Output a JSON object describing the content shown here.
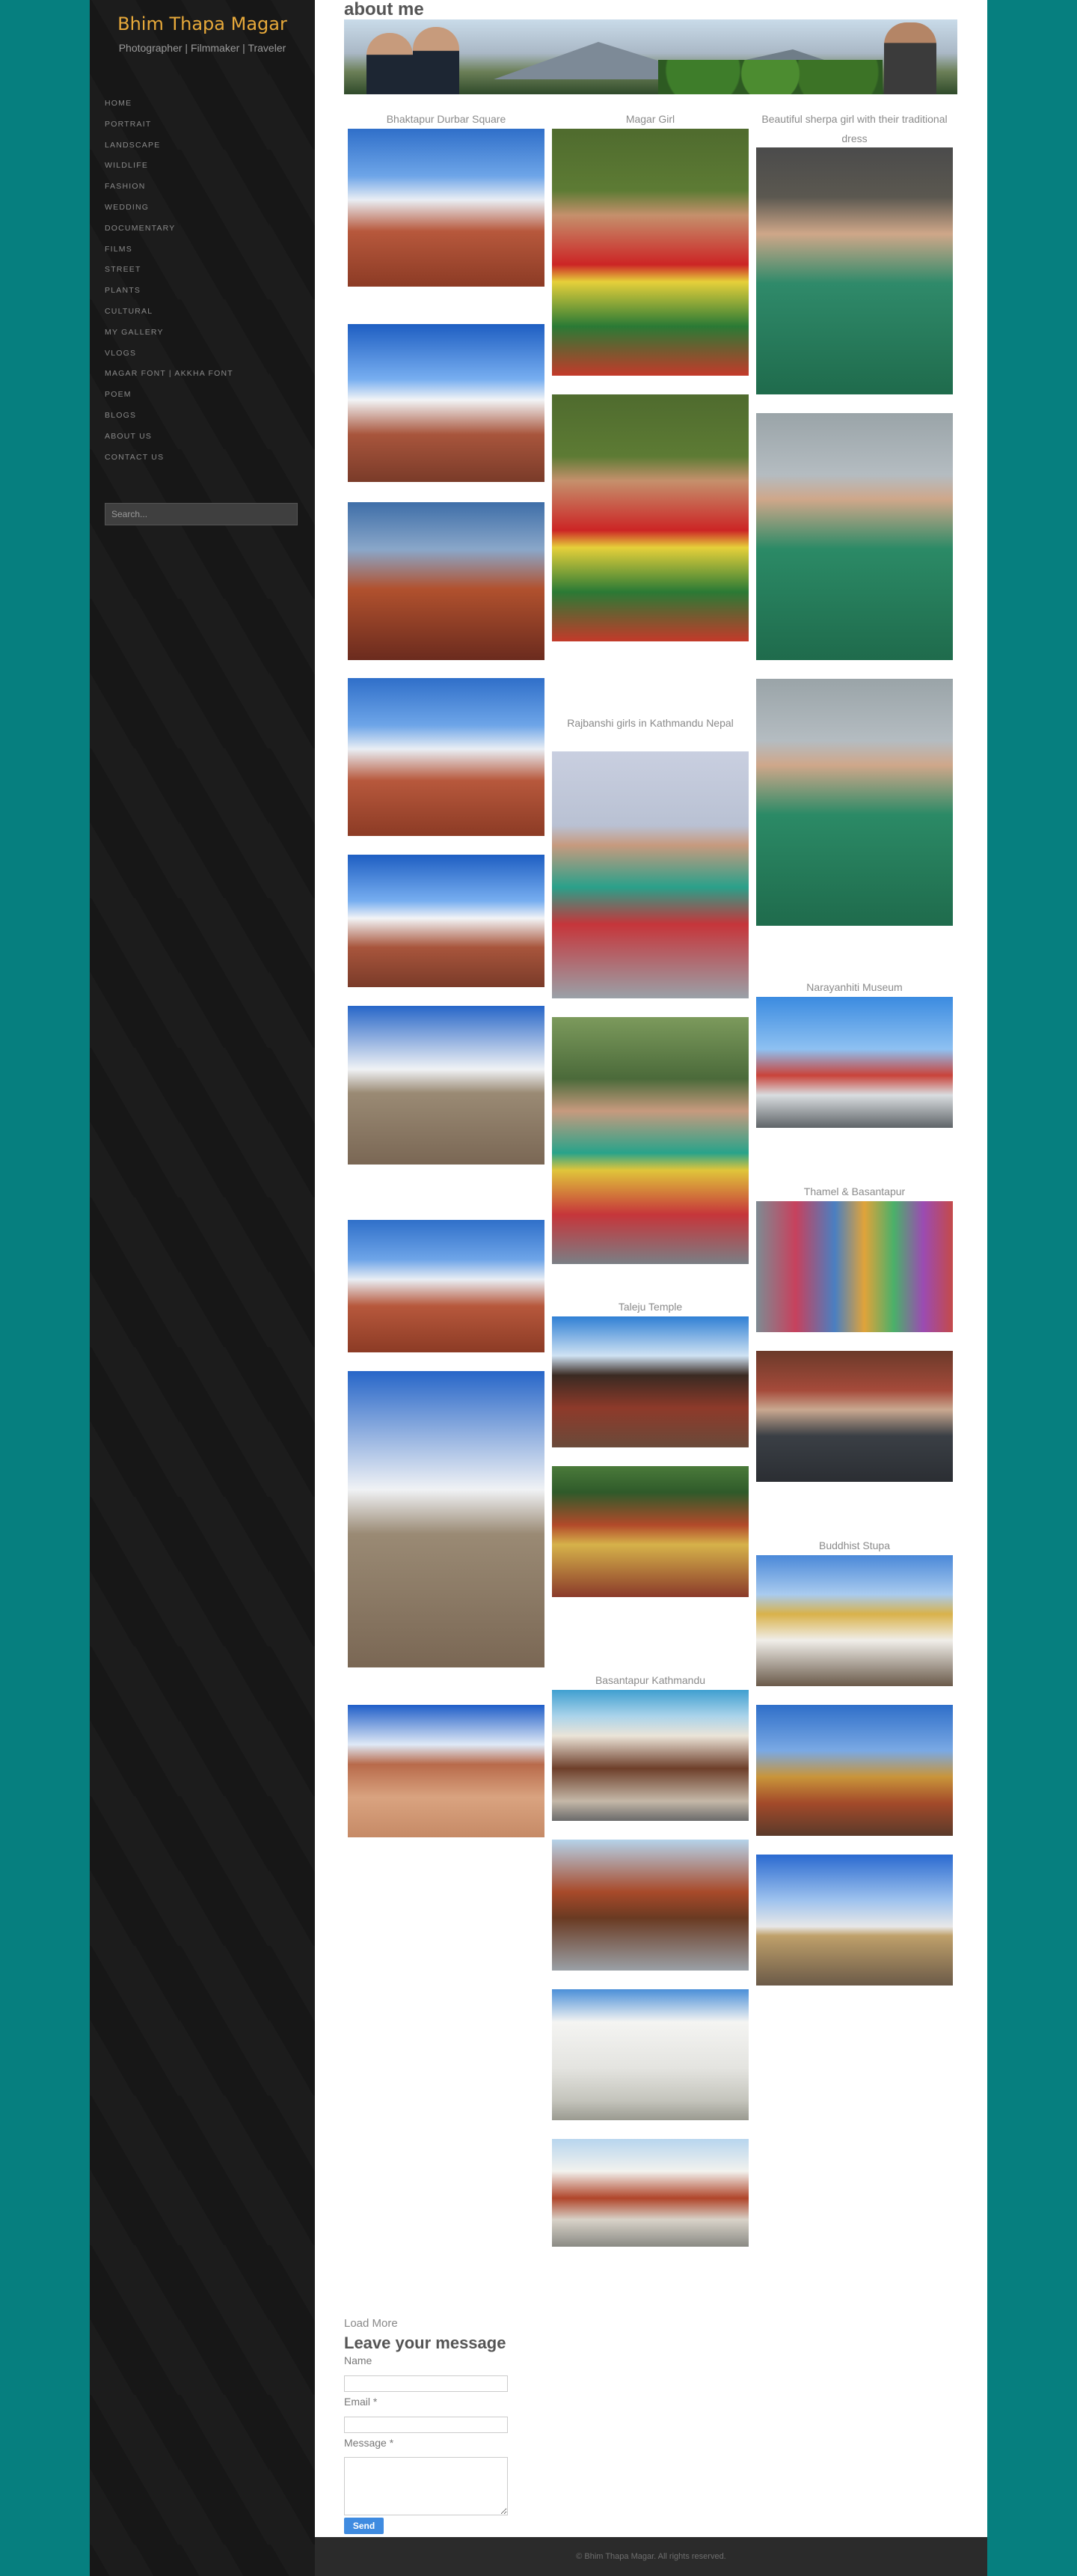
{
  "site": {
    "title": "Bhim Thapa Magar",
    "tagline": "Photographer | Filmmaker | Traveler"
  },
  "nav": [
    "HOME",
    "PORTRAIT",
    "LANDSCAPE",
    "WILDLIFE",
    "FASHION",
    "WEDDING",
    "DOCUMENTARY",
    "FILMS",
    "STREET",
    "PLANTS",
    "CULTURAL",
    "MY GALLERY",
    "VLOGS",
    "MAGAR FONT | AKKHA FONT",
    "POEM",
    "BLOGS",
    "ABOUT US",
    "CONTACT US"
  ],
  "search": {
    "placeholder": "Search..."
  },
  "main": {
    "title": "about me"
  },
  "captions": {
    "bhaktapur": "Bhaktapur Durbar Square",
    "magar": "Magar Girl",
    "sherpa": "Beautiful sherpa girl with their traditional dress",
    "rajbanshi": "Rajbanshi girls  in Kathmandu Nepal",
    "narayanhiti": "Narayanhiti Museum",
    "thamel": "Thamel & Basantapur",
    "taleju": "Taleju Temple",
    "buddhist": "Buddhist  Stupa",
    "basantapur": "Basantapur Kathmandu"
  },
  "form": {
    "load_more": "Load More",
    "title": "Leave your message",
    "name_label": "Name",
    "email_label": "Email *",
    "message_label": "Message *",
    "send_label": "Send"
  },
  "footer": {
    "text": "© Bhim Thapa Magar. All rights reserved."
  },
  "colors": {
    "background": "#067f7f",
    "sidebar": "#171717",
    "title_accent": "#e7a93a",
    "send_button": "#3f8be0"
  }
}
